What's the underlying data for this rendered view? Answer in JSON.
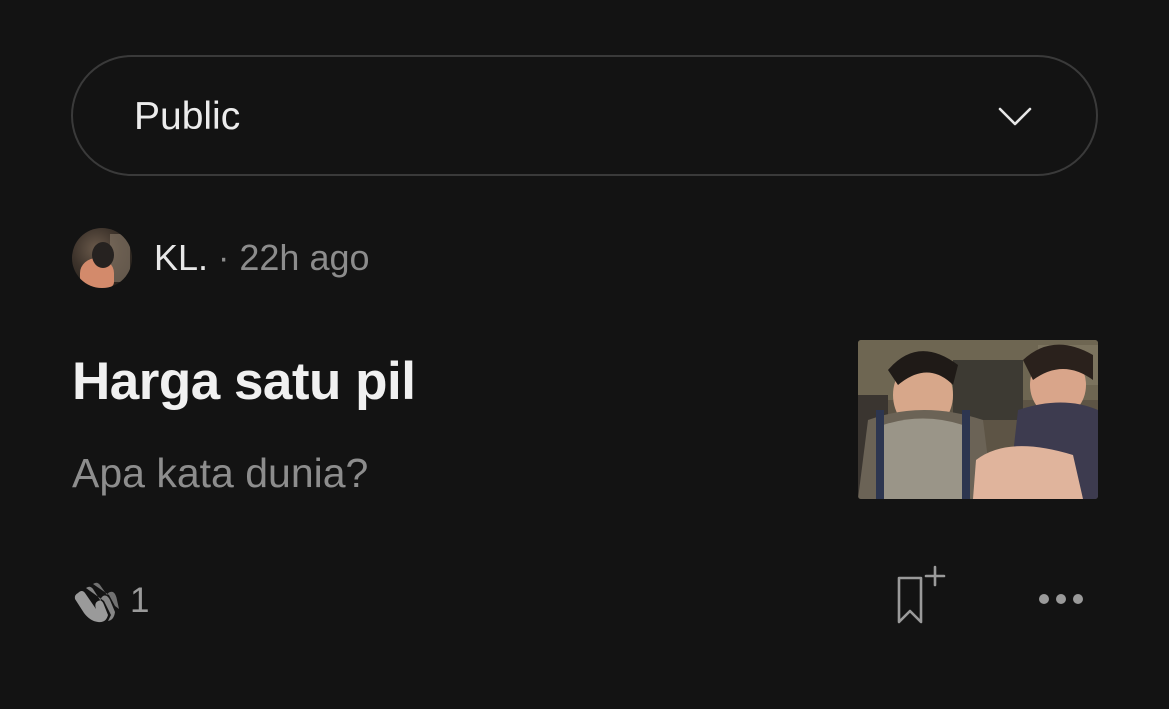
{
  "visibility_select": {
    "selected": "Public",
    "icon": "chevron-down-icon"
  },
  "post": {
    "author": {
      "name": "KL.",
      "separator": "·",
      "time": "22h ago"
    },
    "title": "Harga satu pil",
    "subtitle": "Apa kata dunia?",
    "thumbnail_icon": "post-thumbnail-image"
  },
  "actions": {
    "clap_icon": "clap-icon",
    "clap_count": "1",
    "bookmark_icon": "bookmark-add-icon",
    "more_icon": "more-options-icon"
  },
  "colors": {
    "background": "#131313",
    "border": "#3a3a3a",
    "primary_text": "#f0f0f0",
    "secondary_text": "#8d8d8d"
  }
}
